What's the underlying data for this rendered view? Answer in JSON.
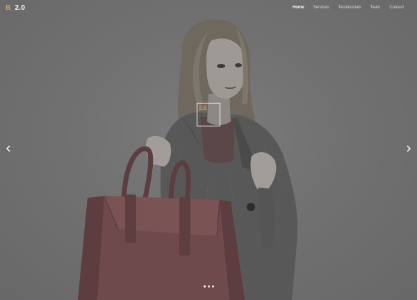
{
  "logo": {
    "prefix": "B",
    "separator": "_",
    "version": "2.0"
  },
  "nav": {
    "items": [
      {
        "label": "Home",
        "active": true
      },
      {
        "label": "Services",
        "active": false
      },
      {
        "label": "Testimonials",
        "active": false
      },
      {
        "label": "Team",
        "active": false
      },
      {
        "label": "Contact",
        "active": false
      }
    ]
  },
  "slider": {
    "badge_text": "2.0",
    "prev_icon": "chevron-left-icon",
    "next_icon": "chevron-right-icon",
    "slide_count": 3,
    "active_slide": 1
  },
  "colors": {
    "background": "#6f6f6f",
    "accent": "#c9a06a",
    "badge_text": "#d9a85e",
    "bag": "#6e4a4c",
    "coat": "#595959",
    "hair": "#7a7367"
  }
}
